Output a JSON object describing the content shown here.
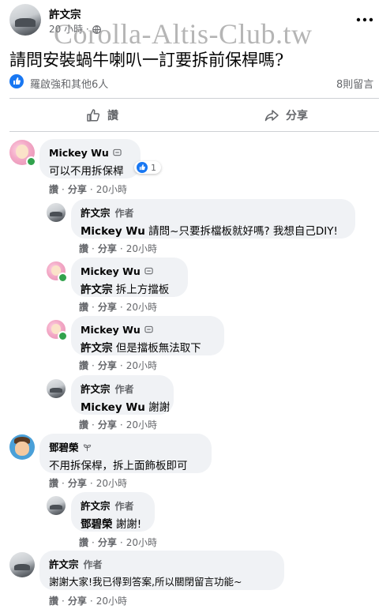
{
  "post": {
    "author": "許文宗",
    "time": "20 小時",
    "privacy_icon": "globe-icon",
    "more_icon": "ellipsis-icon",
    "watermark": "Corolla-Altis-Club.tw",
    "title": "請問安裝蝸牛喇叭一訂要拆前保桿嗎?",
    "reactions_text": "羅啟強和其他6人",
    "comments_count": "8則留言",
    "like_label": "讚",
    "share_label": "分享"
  },
  "colors": {
    "like_blue": "#1877f2",
    "bubble_bg": "#f0f2f5",
    "meta_gray": "#65676b"
  },
  "action_labels": {
    "like": "讚",
    "reply": "分享"
  },
  "comments": [
    {
      "name": "Mickey Wu",
      "author_tag": "",
      "mention": "",
      "text": "可以不用拆保桿",
      "time": "20小時",
      "reaction_count": "1"
    },
    {
      "name": "許文宗",
      "author_tag": "作者",
      "mention": "Mickey Wu",
      "text": "請問~只要拆檔板就好嗎? 我想自己DIY!",
      "time": "20小時"
    },
    {
      "name": "Mickey Wu",
      "author_tag": "",
      "mention": "許文宗",
      "text": "拆上方擋板",
      "time": "20小時"
    },
    {
      "name": "Mickey Wu",
      "author_tag": "",
      "mention": "許文宗",
      "text": "但是擋板無法取下",
      "time": "20小時"
    },
    {
      "name": "許文宗",
      "author_tag": "作者",
      "mention": "Mickey Wu",
      "text": "謝謝",
      "time": "20小時"
    },
    {
      "name": "鄧碧榮",
      "author_tag": "",
      "mention": "",
      "text": "不用拆保桿，拆上面飾板即可",
      "time": "20小時"
    },
    {
      "name": "許文宗",
      "author_tag": "作者",
      "mention": "鄧碧榮",
      "text": "謝謝!",
      "time": "20小時"
    },
    {
      "name": "許文宗",
      "author_tag": "作者",
      "mention": "",
      "text": "謝謝大家!我已得到答案,所以關閉留言功能~",
      "time": "20小時"
    }
  ]
}
